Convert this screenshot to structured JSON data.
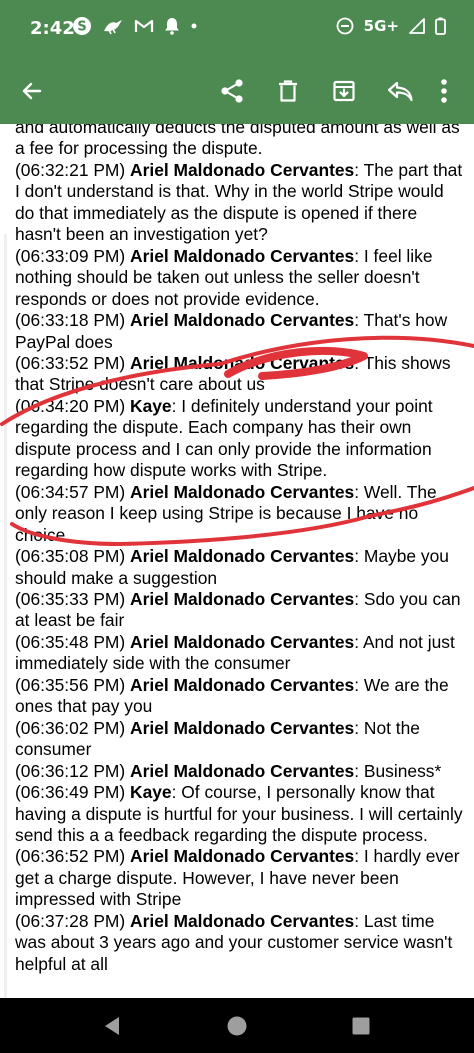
{
  "status_bar": {
    "time": "2:42",
    "left_icons": [
      "s-app-icon",
      "bird-icon",
      "gmail-icon",
      "bell-icon",
      "dot-icon"
    ],
    "network": "5G+",
    "right_icons": [
      "do-not-disturb-icon",
      "signal-icon",
      "battery-icon"
    ]
  },
  "app_bar": {
    "color": "#4c8a52",
    "actions": [
      "back-arrow-icon",
      "share-icon",
      "delete-icon",
      "archive-icon",
      "reply-icon",
      "more-vert-icon"
    ]
  },
  "annotation_color": "#e0333a",
  "messages": [
    {
      "time": "",
      "speaker": "",
      "text": "and automatically deducts the disputed amount as well as a fee for processing the dispute."
    },
    {
      "time": "(06:32:21 PM)",
      "speaker": "Ariel Maldonado Cervantes",
      "text": ": The part that I don't understand is that. Why in the world Stripe would do that immediately as the dispute is opened if there hasn't been an investigation yet?"
    },
    {
      "time": "(06:33:09 PM)",
      "speaker": "Ariel Maldonado Cervantes",
      "text": ": I feel like nothing should be taken out unless the seller doesn't responds or does not provide evidence."
    },
    {
      "time": "(06:33:18 PM)",
      "speaker": "Ariel Maldonado Cervantes",
      "text": ": That's how PayPal does"
    },
    {
      "time": "(06:33:52 PM)",
      "speaker": "Ariel Maldonado Cervantes",
      "text": ": This shows that Stripe doesn't care about us"
    },
    {
      "time": "(06:34:20 PM)",
      "speaker": "Kaye",
      "text": ": I definitely understand your point regarding the dispute. Each company has their own dispute process and I can only provide the information regarding how dispute works with Stripe."
    },
    {
      "time": "(06:34:57 PM)",
      "speaker": "Ariel Maldonado Cervantes",
      "text": ": Well. The only reason I keep using Stripe is because I have no choice."
    },
    {
      "time": "(06:35:08 PM)",
      "speaker": "Ariel Maldonado Cervantes",
      "text": ": Maybe you should make a suggestion"
    },
    {
      "time": "(06:35:33 PM)",
      "speaker": "Ariel Maldonado Cervantes",
      "text": ": Sdo you can at least be fair"
    },
    {
      "time": "(06:35:48 PM)",
      "speaker": "Ariel Maldonado Cervantes",
      "text": ": And not just immediately side with the consumer"
    },
    {
      "time": "(06:35:56 PM)",
      "speaker": "Ariel Maldonado Cervantes",
      "text": ": We are the ones that pay you"
    },
    {
      "time": "(06:36:02 PM)",
      "speaker": "Ariel Maldonado Cervantes",
      "text": ": Not the consumer"
    },
    {
      "time": "(06:36:12 PM)",
      "speaker": "Ariel Maldonado Cervantes",
      "text": ": Business*"
    },
    {
      "time": "(06:36:49 PM)",
      "speaker": "Kaye",
      "text": ": Of course, I personally know that having a dispute is hurtful for your business. I will certainly send this a a feedback regarding the dispute process."
    },
    {
      "time": "(06:36:52 PM)",
      "speaker": "Ariel Maldonado Cervantes",
      "text": ": I hardly ever get a charge dispute. However, I have never been impressed with Stripe"
    },
    {
      "time": "(06:37:28 PM)",
      "speaker": "Ariel Maldonado Cervantes",
      "text": ": Last time was about 3 years ago and your customer service wasn't helpful at all"
    }
  ],
  "nav_bar": {
    "buttons": [
      "back-triangle-icon",
      "home-circle-icon",
      "recents-square-icon"
    ]
  }
}
